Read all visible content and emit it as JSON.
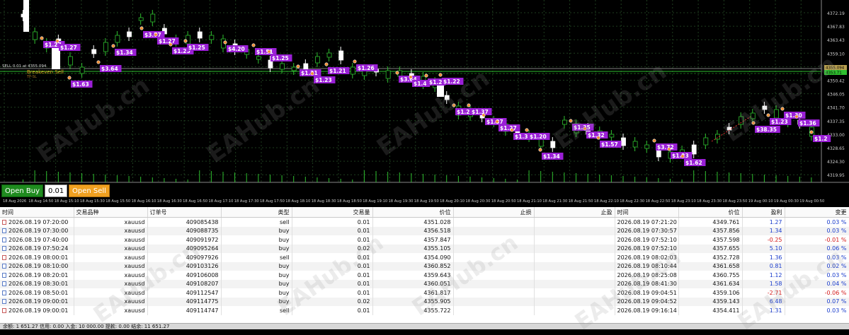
{
  "chart": {
    "order_label": "SELL 0.01 at 4355.094",
    "breakeven_label": "Breakeven Sell",
    "tp_label": "TP-SL",
    "price_tag_current": "4355.094",
    "price_tag_be": "4353.71",
    "price_axis": [
      "4372.19",
      "4367.83",
      "4363.43",
      "4359.10",
      "4354.75",
      "4350.42",
      "4346.05",
      "4341.70",
      "4337.35",
      "4333.00",
      "4328.65",
      "4324.30",
      "4319.95"
    ],
    "time_axis": [
      "18 Aug 2026",
      "18 Aug 14:50",
      "18 Aug 15:10",
      "18 Aug 15:30",
      "18 Aug 15:50",
      "18 Aug 16:10",
      "18 Aug 16:30",
      "18 Aug 16:50",
      "18 Aug 17:10",
      "18 Aug 17:30",
      "18 Aug 17:50",
      "18 Aug 18:10",
      "18 Aug 18:30",
      "18 Aug 18:50",
      "18 Aug 19:10",
      "18 Aug 19:30",
      "18 Aug 19:50",
      "18 Aug 20:10",
      "18 Aug 20:30",
      "18 Aug 20:50",
      "18 Aug 21:10",
      "18 Aug 21:30",
      "18 Aug 21:50",
      "18 Aug 22:10",
      "18 Aug 22:30",
      "18 Aug 22:50",
      "18 Aug 23:10",
      "18 Aug 23:30",
      "18 Aug 23:50",
      "19 Aug 00:10",
      "19 Aug 00:30",
      "19 Aug 00:50"
    ],
    "profit_tags": [
      "$1.27",
      "$1.27",
      "$3.64",
      "$1.63",
      "$1.34",
      "$3.77",
      "$1.27",
      "$1.25",
      "$1.25",
      "$4.20",
      "$1.51",
      "$1.25",
      "$1.21",
      "$1.23",
      "$1.21",
      "$1.26",
      "$3.64",
      "$1.4",
      "$1.2",
      "$1.22",
      "$1.27",
      "$1.37",
      "$1.37",
      "$1.27",
      "$1.37",
      "$1.20",
      "$1.34",
      "$1.25",
      "$1.32",
      "$1.57",
      "$3.72",
      "$1.23",
      "$1.62",
      "$38.35",
      "$1.23",
      "$1.30",
      "$1.36",
      "$1.2"
    ]
  },
  "trade_panel": {
    "buy_label": "Open Buy",
    "lot": "0.01",
    "sell_label": "Open Sell"
  },
  "table": {
    "headers": [
      "时间",
      "交易品种",
      "订单号",
      "类型",
      "交易量",
      "价位",
      "止损",
      "止盈",
      "时间",
      "价位",
      "盈利",
      "变更"
    ],
    "rows": [
      [
        "2026.08.19 07:20:00",
        "xauusd",
        "409085438",
        "sell",
        "0.01",
        "4351.028",
        "",
        "",
        "2026.08.19 07:21:20",
        "4349.761",
        "1.27",
        "0.03 %"
      ],
      [
        "2026.08.19 07:30:00",
        "xauusd",
        "409088735",
        "buy",
        "0.01",
        "4356.518",
        "",
        "",
        "2026.08.19 07:30:57",
        "4357.856",
        "1.34",
        "0.03 %"
      ],
      [
        "2026.08.19 07:40:00",
        "xauusd",
        "409091972",
        "buy",
        "0.01",
        "4357.847",
        "",
        "",
        "2026.08.19 07:52:10",
        "4357.598",
        "-0.25",
        "-0.01 %"
      ],
      [
        "2026.08.19 07:50:24",
        "xauusd",
        "409095264",
        "buy",
        "0.02",
        "4355.105",
        "",
        "",
        "2026.08.19 07:52:10",
        "4357.655",
        "5.10",
        "0.06 %"
      ],
      [
        "2026.08.19 08:00:01",
        "xauusd",
        "409097926",
        "sell",
        "0.01",
        "4354.090",
        "",
        "",
        "2026.08.19 08:02:03",
        "4352.728",
        "1.36",
        "0.03 %"
      ],
      [
        "2026.08.19 08:10:00",
        "xauusd",
        "409103126",
        "buy",
        "0.01",
        "4360.852",
        "",
        "",
        "2026.08.19 08:10:44",
        "4361.658",
        "0.81",
        "0.02 %"
      ],
      [
        "2026.08.19 08:20:01",
        "xauusd",
        "409106008",
        "buy",
        "0.01",
        "4359.643",
        "",
        "",
        "2026.08.19 08:25:08",
        "4360.755",
        "1.12",
        "0.03 %"
      ],
      [
        "2026.08.19 08:30:01",
        "xauusd",
        "409108207",
        "buy",
        "0.01",
        "4360.051",
        "",
        "",
        "2026.08.19 08:41:30",
        "4361.634",
        "1.58",
        "0.04 %"
      ],
      [
        "2026.08.19 08:50:01",
        "xauusd",
        "409112547",
        "buy",
        "0.01",
        "4361.817",
        "",
        "",
        "2026.08.19 09:04:51",
        "4359.106",
        "-2.71",
        "-0.06 %"
      ],
      [
        "2026.08.19 09:00:01",
        "xauusd",
        "409114775",
        "buy",
        "0.02",
        "4355.905",
        "",
        "",
        "2026.08.19 09:04:52",
        "4359.143",
        "6.48",
        "0.07 %"
      ],
      [
        "2026.08.19 09:00:01",
        "xauusd",
        "409114747",
        "sell",
        "0.01",
        "4355.722",
        "",
        "",
        "2026.08.19 09:16:14",
        "4354.411",
        "1.31",
        "0.03 %"
      ]
    ]
  },
  "status_bar": "余额: 1 651.27  信用: 0.00  入金: 10 000.00  提款: 0.00  结余: 11 651.27",
  "watermark": "EAHub.cn",
  "colors": {
    "profit": "#1a3ccc",
    "loss": "#d41a1a",
    "tag_bg": "#9a1fd6",
    "buy": "#1f8b1f",
    "sell": "#f0a020"
  }
}
